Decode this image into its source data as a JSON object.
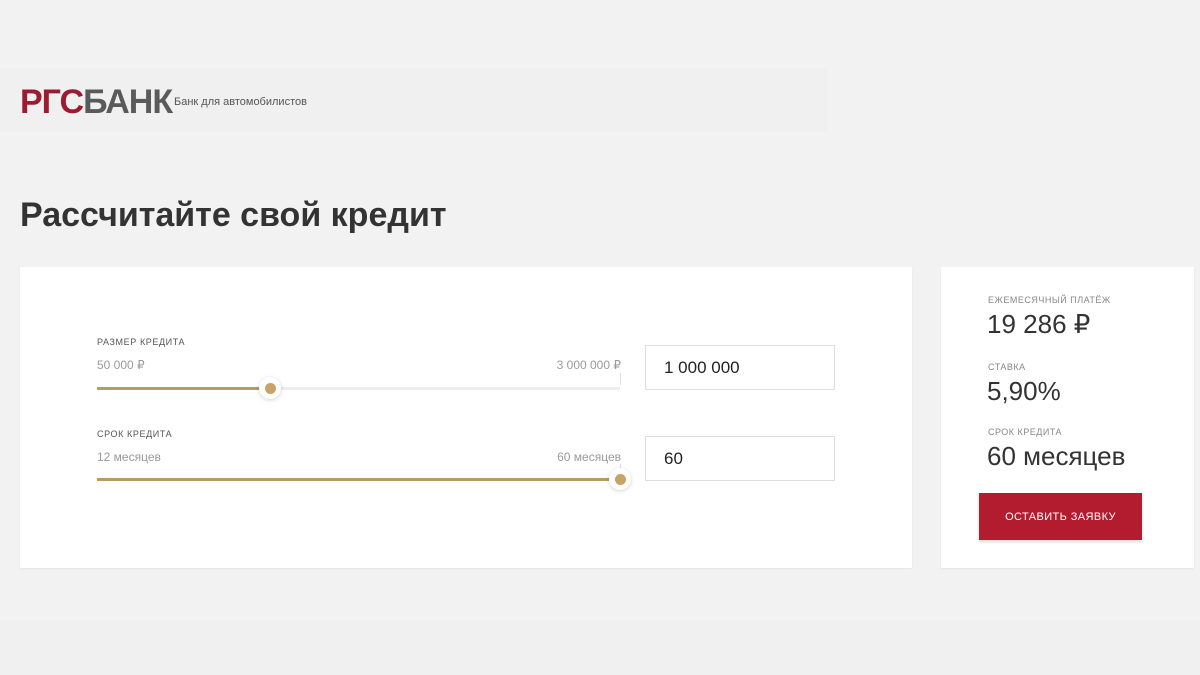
{
  "header": {
    "logo_part1": "РГС",
    "logo_part2": "БАНК",
    "tagline": "Банк для автомобилистов"
  },
  "page_title": "Рассчитайте свой кредит",
  "calculator": {
    "amount": {
      "label": "РАЗМЕР КРЕДИТА",
      "min_label": "50 000 ₽",
      "max_label": "3 000 000 ₽",
      "value": "1 000 000",
      "slider_fraction": 0.33
    },
    "term": {
      "label": "СРОК КРЕДИТА",
      "min_label": "12 месяцев",
      "max_label": "60 месяцев",
      "value": "60",
      "slider_fraction": 1.0
    }
  },
  "summary": {
    "payment_label": "ЕЖЕМЕСЯЧНЫЙ ПЛАТЁЖ",
    "payment_value": "19 286 ₽",
    "rate_label": "СТАВКА",
    "rate_value": "5,90%",
    "term_label": "СРОК КРЕДИТА",
    "term_value": "60 месяцев",
    "apply_label": "ОСТАВИТЬ ЗАЯВКУ"
  },
  "colors": {
    "brand_red": "#b31b2f",
    "logo_red": "#9b1b30",
    "slider_gold": "#c9a266"
  }
}
